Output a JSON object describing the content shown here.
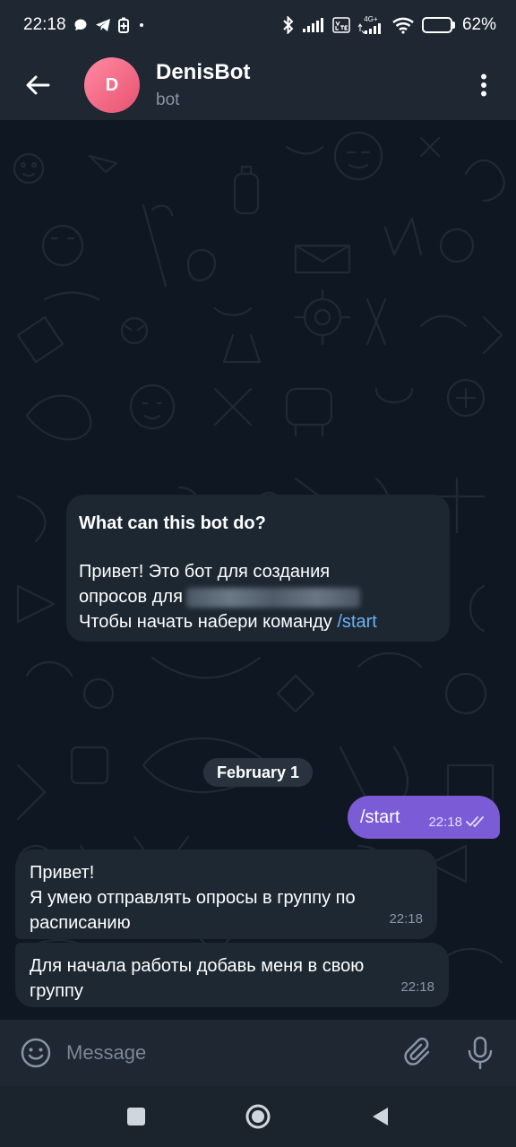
{
  "status_bar": {
    "time": "22:18",
    "network_label": "4G+",
    "battery_percent": "62%",
    "battery_level": 0.62,
    "icons": [
      "message-icon",
      "telegram-icon",
      "battery-saver-icon",
      "bluetooth-icon",
      "signal-icon",
      "volte-icon",
      "wifi-icon",
      "battery-icon"
    ]
  },
  "header": {
    "avatar_letter": "D",
    "title": "DenisBot",
    "subtitle": "bot",
    "avatar_color": "#e8526f"
  },
  "bot_info": {
    "heading": "What can this bot do?",
    "line1": "Привет! Это бот для создания",
    "line2": "опросов для",
    "line3": "Чтобы начать набери команду",
    "command": "/start"
  },
  "date_divider": "February 1",
  "messages": {
    "outgoing": {
      "text": "/start",
      "time": "22:18"
    },
    "incoming1": {
      "line1": "Привет!",
      "line2": "Я умею отправлять опросы в группу по",
      "line3": "расписанию",
      "time": "22:18"
    },
    "incoming2": {
      "line1": "Для начала работы добавь меня в свою",
      "line2": "группу",
      "time": "22:18"
    }
  },
  "composer": {
    "placeholder": "Message"
  },
  "colors": {
    "accent": "#6ab3f3",
    "outgoing_bubble": "#7b5bd6",
    "incoming_bubble": "#1e2833",
    "header_bg": "#1e2732"
  }
}
